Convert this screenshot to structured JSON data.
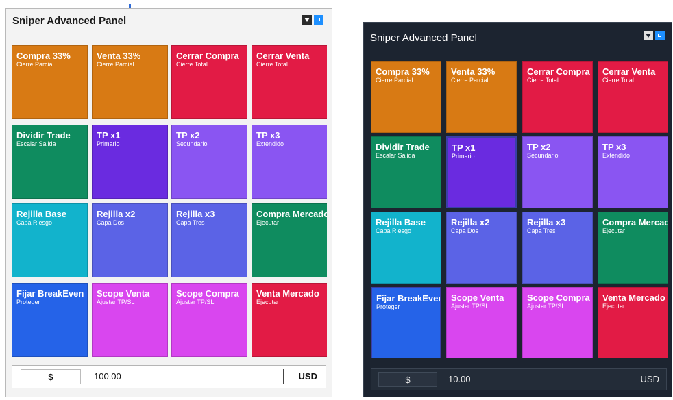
{
  "panels": [
    {
      "id": "light",
      "title": "Sniper Advanced Panel",
      "controls": {
        "collapse_icon": "collapse-icon",
        "restore_icon": "restore-icon"
      },
      "buttons": [
        {
          "label": "Compra 33%",
          "sub": "Cierre Parcial",
          "color": "#d87a14"
        },
        {
          "label": "Venta 33%",
          "sub": "Cierre Parcial",
          "color": "#d87a14"
        },
        {
          "label": "Cerrar Compra",
          "sub": "Cierre Total",
          "color": "#e21b45"
        },
        {
          "label": "Cerrar Venta",
          "sub": "Cierre Total",
          "color": "#e21b45"
        },
        {
          "label": "Dividir Trade",
          "sub": "Escalar Salida",
          "color": "#0f8c5f"
        },
        {
          "label": "TP x1",
          "sub": "Primario",
          "color": "#6a2be0"
        },
        {
          "label": "TP x2",
          "sub": "Secundario",
          "color": "#8a55f2"
        },
        {
          "label": "TP x3",
          "sub": "Extendido",
          "color": "#8a55f2"
        },
        {
          "label": "Rejilla Base",
          "sub": "Capa Riesgo",
          "color": "#12b3cc"
        },
        {
          "label": "Rejilla x2",
          "sub": "Capa Dos",
          "color": "#5b63e6"
        },
        {
          "label": "Rejilla x3",
          "sub": "Capa Tres",
          "color": "#5b63e6"
        },
        {
          "label": "Compra Mercado",
          "sub": "Ejecutar",
          "color": "#0f8c5f"
        },
        {
          "label": "Fijar BreakEven",
          "sub": "Proteger",
          "color": "#2563e8"
        },
        {
          "label": "Scope Venta",
          "sub": "Ajustar TP/SL",
          "color": "#d946ef"
        },
        {
          "label": "Scope Compra",
          "sub": "Ajustar TP/SL",
          "color": "#d946ef"
        },
        {
          "label": "Venta Mercado",
          "sub": "Ejecutar",
          "color": "#e21b45"
        }
      ],
      "footer": {
        "currency_symbol": "$",
        "amount": "100.00",
        "unit": "USD"
      }
    },
    {
      "id": "dark",
      "title": "Sniper Advanced Panel",
      "controls": {
        "collapse_icon": "collapse-icon",
        "restore_icon": "restore-icon"
      },
      "buttons": [
        {
          "label": "Compra 33%",
          "sub": "Cierre Parcial",
          "color": "#d87a14"
        },
        {
          "label": "Venta 33%",
          "sub": "Cierre Parcial",
          "color": "#d87a14"
        },
        {
          "label": "Cerrar Compra",
          "sub": "Cierre Total",
          "color": "#e21b45"
        },
        {
          "label": "Cerrar Venta",
          "sub": "Cierre Total",
          "color": "#e21b45"
        },
        {
          "label": "Dividir Trade",
          "sub": "Escalar Salida",
          "color": "#0f8c5f"
        },
        {
          "label": "TP x1",
          "sub": "Primario",
          "color": "#6a2be0",
          "selected": true
        },
        {
          "label": "TP x2",
          "sub": "Secundario",
          "color": "#8a55f2"
        },
        {
          "label": "TP x3",
          "sub": "Extendido",
          "color": "#8a55f2"
        },
        {
          "label": "Rejilla Base",
          "sub": "Capa Riesgo",
          "color": "#12b3cc"
        },
        {
          "label": "Rejilla x2",
          "sub": "Capa Dos",
          "color": "#5b63e6"
        },
        {
          "label": "Rejilla x3",
          "sub": "Capa Tres",
          "color": "#5b63e6"
        },
        {
          "label": "Compra Mercado",
          "sub": "Ejecutar",
          "color": "#0f8c5f"
        },
        {
          "label": "Fijar BreakEven",
          "sub": "Proteger",
          "color": "#2563e8",
          "selected": true
        },
        {
          "label": "Scope Venta",
          "sub": "Ajustar TP/SL",
          "color": "#d946ef"
        },
        {
          "label": "Scope Compra",
          "sub": "Ajustar TP/SL",
          "color": "#d946ef"
        },
        {
          "label": "Venta Mercado",
          "sub": "Ejecutar",
          "color": "#e21b45"
        }
      ],
      "footer": {
        "currency_symbol": "$",
        "amount": "10.00",
        "unit": "USD"
      }
    }
  ]
}
